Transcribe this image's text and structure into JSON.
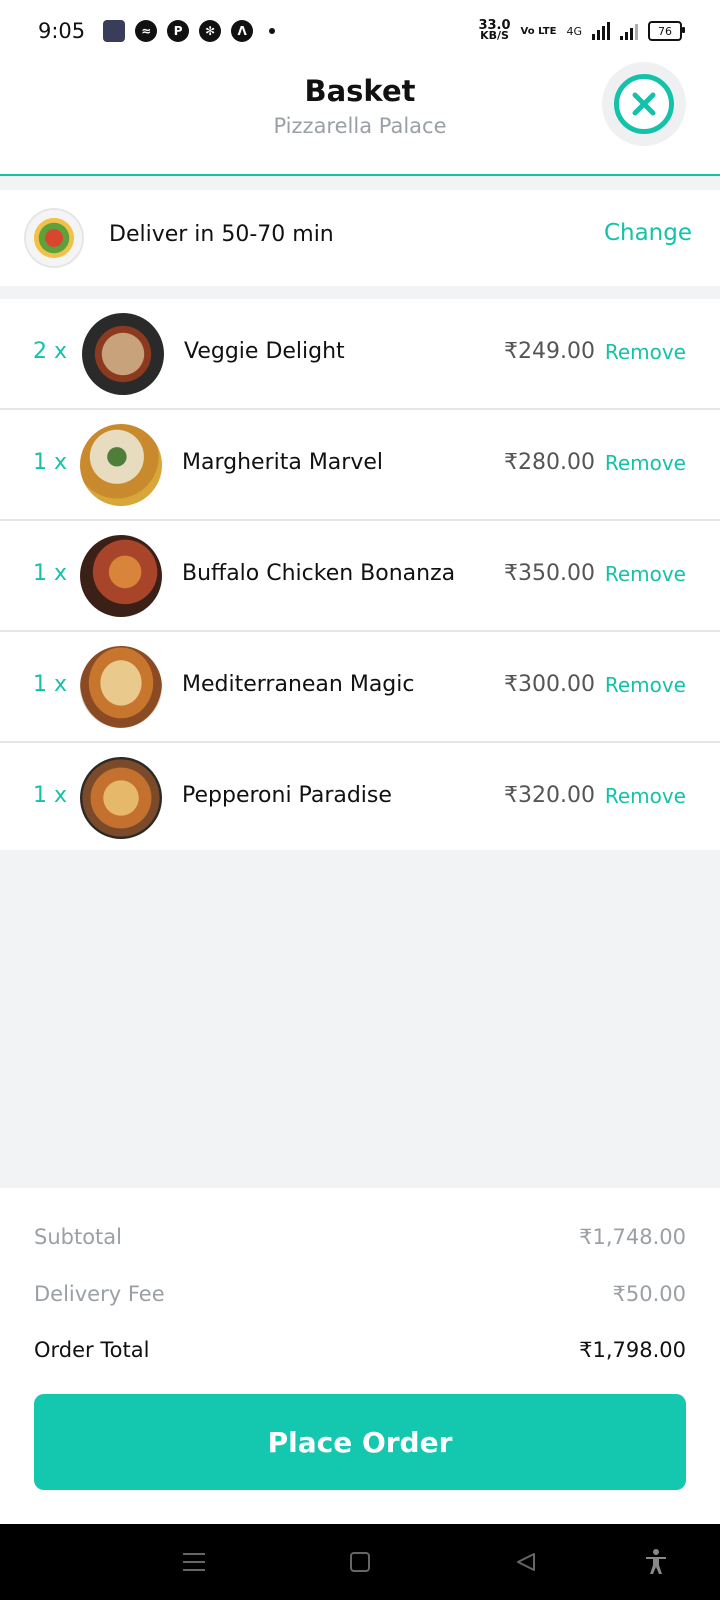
{
  "status_bar": {
    "time": "9:05",
    "net_speed_value": "33.0",
    "net_speed_unit": "KB/S",
    "volte": "Vo LTE",
    "network": "4G",
    "battery": "76"
  },
  "header": {
    "title": "Basket",
    "subtitle": "Pizzarella Palace"
  },
  "delivery": {
    "text": "Deliver in 50-70 min",
    "change_label": "Change"
  },
  "items": [
    {
      "qty": "2 x",
      "name": "Veggie Delight",
      "price": "₹249.00",
      "remove_label": "Remove"
    },
    {
      "qty": "1 x",
      "name": "Margherita Marvel",
      "price": "₹280.00",
      "remove_label": "Remove"
    },
    {
      "qty": "1 x",
      "name": "Buffalo Chicken Bonanza",
      "price": "₹350.00",
      "remove_label": "Remove"
    },
    {
      "qty": "1 x",
      "name": "Mediterranean Magic",
      "price": "₹300.00",
      "remove_label": "Remove"
    },
    {
      "qty": "1 x",
      "name": "Pepperoni Paradise",
      "price": "₹320.00",
      "remove_label": "Remove"
    }
  ],
  "summary": {
    "subtotal_label": "Subtotal",
    "subtotal_value": "₹1,748.00",
    "delivery_fee_label": "Delivery Fee",
    "delivery_fee_value": "₹50.00",
    "order_total_label": "Order Total",
    "order_total_value": "₹1,798.00"
  },
  "actions": {
    "place_order_label": "Place Order"
  },
  "colors": {
    "accent": "#14c2a9",
    "button": "#14c8b0",
    "muted_text": "#9aa0a6",
    "background_gray": "#f2f3f5"
  }
}
